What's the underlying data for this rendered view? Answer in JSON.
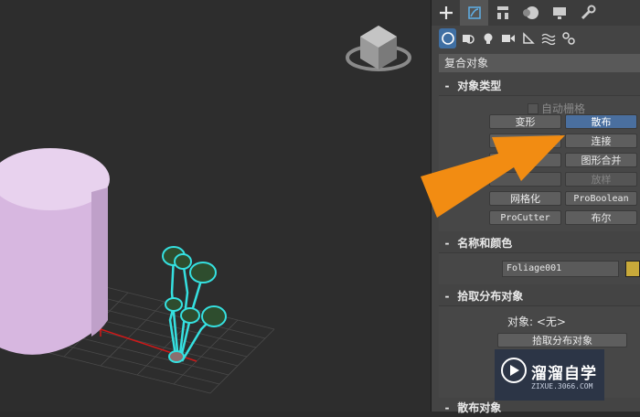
{
  "command_panel": {
    "main_tabs": [
      "create-icon",
      "modify-icon",
      "hierarchy-icon",
      "motion-icon",
      "display-icon",
      "utilities-icon"
    ],
    "sub_tabs": [
      "geometry-icon",
      "shapes-icon",
      "lights-icon",
      "cameras-icon",
      "helpers-icon",
      "space-warps-icon",
      "systems-icon"
    ],
    "category_dropdown": "复合对象"
  },
  "object_type": {
    "title": "对象类型",
    "autogrid_label": "自动栅格",
    "buttons": {
      "morph": "变形",
      "scatter": "散布",
      "conform": "",
      "connect": "连接",
      "blobmesh": "",
      "shapemerge": "图形合并",
      "terrain": "",
      "loft": "放样",
      "mesher": "网格化",
      "proboolean": "ProBoolean",
      "procutter": "ProCutter",
      "boolean": "布尔"
    }
  },
  "name_color": {
    "title": "名称和颜色",
    "name_value": "Foliage001",
    "color": "#c8a93a"
  },
  "pick_distribution": {
    "title": "拾取分布对象",
    "object_label": "对象:",
    "object_value": "<无>",
    "pick_button": "拾取分布对象"
  },
  "scatter_objects": {
    "title": "散布对象"
  },
  "rollout_sign": "-",
  "watermark": {
    "title": "溜溜自学",
    "subtitle": "ZIXUE.3066.COM"
  },
  "colors": {
    "accent": "#4a6f9f",
    "arrow": "#f28c12",
    "cylinder": "#d7b7e0",
    "selection": "#35e0e0"
  }
}
